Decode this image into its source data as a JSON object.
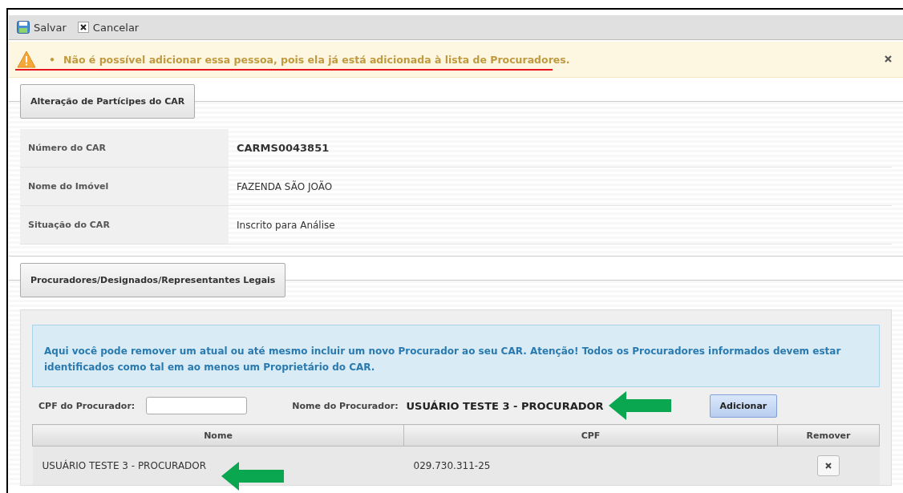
{
  "toolbar": {
    "buttons": [
      {
        "kind": "save",
        "label": "Salvar"
      },
      {
        "kind": "cancel",
        "label": "Cancelar"
      }
    ]
  },
  "alert": {
    "bullet": "•",
    "message": "Não é possível adicionar essa pessoa, pois ela já está adicionada à lista de Procuradores."
  },
  "car_section": {
    "title": "Alteração de Partícipes do CAR",
    "fields": [
      {
        "label": "Número do CAR",
        "value": "CARMS0043851",
        "bold": true
      },
      {
        "label": "Nome do Imóvel",
        "value": "FAZENDA SÃO JOÃO",
        "bold": false
      },
      {
        "label": "Situação do CAR",
        "value": "Inscrito para Análise",
        "bold": false
      }
    ]
  },
  "procuradores_section": {
    "title": "Procuradores/Designados/Representantes Legais",
    "info": "Aqui você pode remover um atual ou até mesmo incluir um novo Procurador ao seu CAR. Atenção! Todos os Procuradores informados devem estar identificados como tal em ao menos um Proprietário do CAR.",
    "cpf_label": "CPF do Procurador:",
    "name_label": "Nome do Procurador:",
    "name_value": "USUÁRIO TESTE 3 - PROCURADOR",
    "add_button": "Adicionar",
    "table": {
      "columns": [
        "Nome",
        "CPF",
        "Remover"
      ],
      "rows": [
        {
          "nome": "USUÁRIO TESTE 3 - PROCURADOR",
          "cpf": "029.730.311-25"
        }
      ]
    }
  }
}
